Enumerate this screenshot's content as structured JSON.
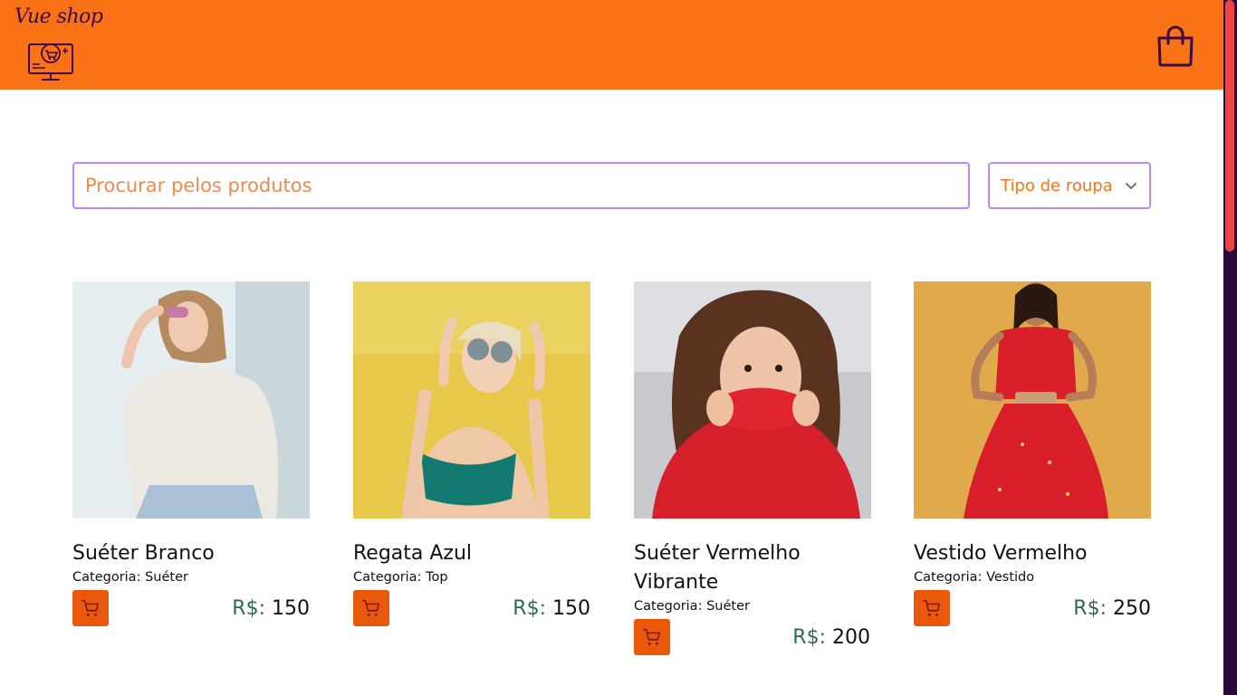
{
  "header": {
    "brand": "Vue shop",
    "logo_icon": "computer-cart-icon",
    "bag_icon": "shopping-bag-icon",
    "background": "#f97316"
  },
  "search": {
    "placeholder": "Procurar pelos produtos"
  },
  "filter": {
    "label": "Tipo de roupa"
  },
  "products": [
    {
      "name": "Suéter Branco",
      "category_label": "Categoria: ",
      "category": "Suéter",
      "currency": "R$:",
      "price": "150"
    },
    {
      "name": "Regata Azul",
      "category_label": "Categoria: ",
      "category": "Top",
      "currency": "R$:",
      "price": "150"
    },
    {
      "name": "Suéter Vermelho Vibrante",
      "category_label": "Categoria: ",
      "category": "Suéter",
      "currency": "R$:",
      "price": "200"
    },
    {
      "name": "Vestido Vermelho",
      "category_label": "Categoria: ",
      "category": "Vestido",
      "currency": "R$:",
      "price": "250"
    }
  ],
  "colors": {
    "accent": "#f97316",
    "button": "#ea580c",
    "input_border": "#c084fc",
    "currency": "#2f6b4f"
  }
}
